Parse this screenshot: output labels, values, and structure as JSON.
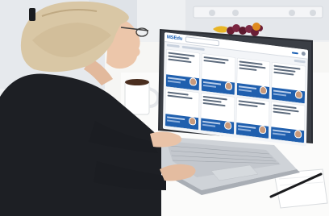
{
  "screen": {
    "logo_text": "MSEdu",
    "subscribe_label": "",
    "cards": [
      {
        "name": "card-1"
      },
      {
        "name": "card-2"
      },
      {
        "name": "card-3"
      },
      {
        "name": "card-4"
      },
      {
        "name": "card-5"
      },
      {
        "name": "card-6"
      },
      {
        "name": "card-7"
      },
      {
        "name": "card-8"
      }
    ]
  },
  "colors": {
    "brand_blue": "#1f5fae",
    "screen_background": "#f3f5f8",
    "laptop_silver": "#cfd3d8",
    "sweater": "#1d1f24",
    "hair": "#d9c7a5"
  }
}
